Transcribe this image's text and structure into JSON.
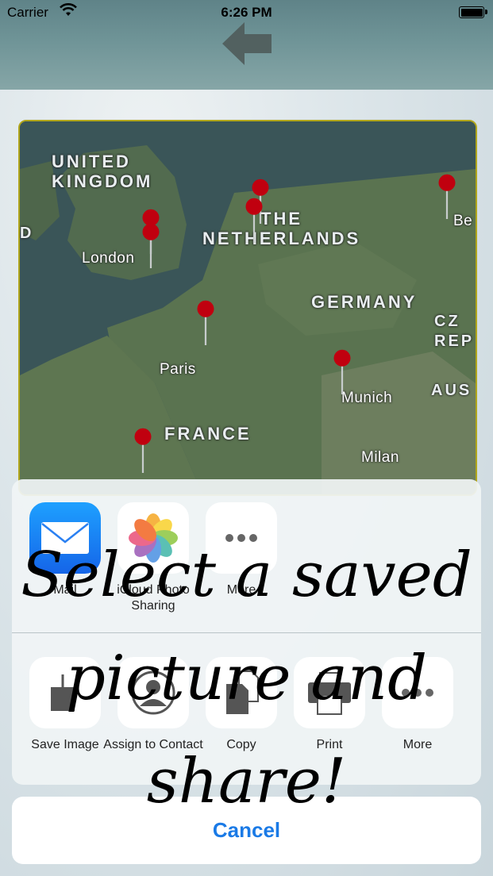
{
  "status_bar": {
    "carrier": "Carrier",
    "time": "6:26 PM"
  },
  "map": {
    "labels": {
      "uk": "UNITED\nKINGDOM",
      "netherlands": "THE\nNETHERLANDS",
      "germany": "GERMANY",
      "france": "FRANCE",
      "london": "London",
      "paris": "Paris",
      "munich": "Munich",
      "milan": "Milan",
      "be": "Be",
      "cz": "CZ\nREP",
      "aus": "AUS",
      "d": "D"
    }
  },
  "share_sheet": {
    "row1": [
      {
        "label": "Mail"
      },
      {
        "label": "iCloud Photo Sharing"
      },
      {
        "label": "More"
      }
    ],
    "row2": [
      {
        "label": "Save Image"
      },
      {
        "label": "Assign to Contact"
      },
      {
        "label": "Copy"
      },
      {
        "label": "Print"
      },
      {
        "label": "More"
      }
    ],
    "cancel": "Cancel"
  },
  "overlay_text": "Select a saved picture and share!",
  "colors": {
    "accent": "#1a7ae6",
    "pin": "#c0000f",
    "map_border": "#b1a61c"
  }
}
